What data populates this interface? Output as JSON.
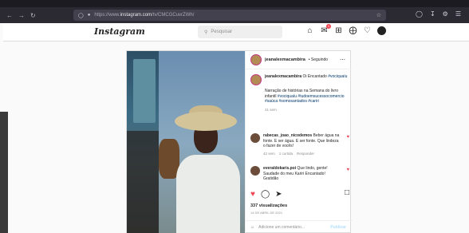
{
  "browser": {
    "url_prefix": "https://www.",
    "url_domain": "instagram.com",
    "url_path": "/tv/CMCGCuvrZWh/"
  },
  "header": {
    "logo": "Instagram",
    "search_placeholder": "Pesquisar",
    "notif_count": "1"
  },
  "post": {
    "username": "jeanalexmacambira",
    "follow_text": "• Seguindo",
    "caption_text": "Oi Encantado",
    "caption_hashtag": "#vociquaíu",
    "caption_body": "Narração de histórias na Semana do livro infantil ",
    "caption_tags": "#vociquaíu #tudoemsucessocomercio #saúca #somosantados #cariri",
    "caption_time": "41 sem",
    "comments": [
      {
        "username": "rabecas_joao_nicodemos",
        "text": "Beber água na fonte. E ser água. E ser fonte. Que lindeza o fazer de vocês!",
        "time": "42 sem",
        "likes": "1 curtida",
        "reply": "Responder"
      },
      {
        "username": "everaldokaris.poi",
        "text": "Que lindo, gente! Saudade do meu Kariri Encantado! Gratidão"
      }
    ],
    "views": "337 visualizações",
    "date": "14 DE ABRIL DE 2021",
    "add_comment_placeholder": "Adicione um comentário...",
    "publish_label": "Publicar"
  }
}
